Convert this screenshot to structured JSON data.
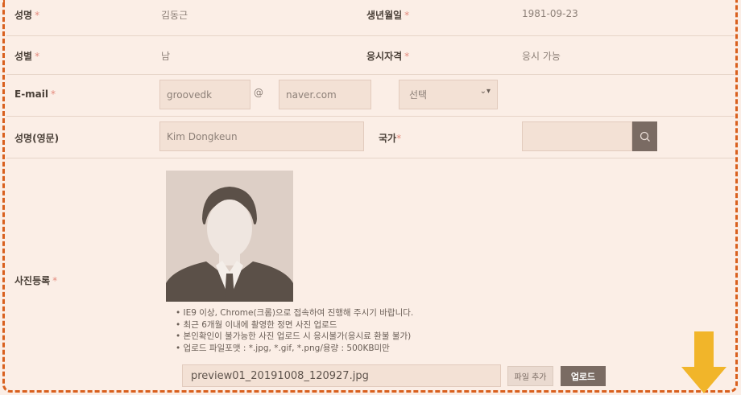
{
  "form": {
    "name_label": "성명",
    "name_value": "김동근",
    "birth_label": "생년월일",
    "birth_value": "1981-09-23",
    "gender_label": "성별",
    "gender_value": "남",
    "qual_label": "응시자격",
    "qual_value": "응시 가능",
    "email_label": "E-mail",
    "email_user": "groovedk",
    "email_at": "@",
    "email_domain": "naver.com",
    "email_select": "선택",
    "eng_name_label": "성명(영문)",
    "eng_name_value": "Kim Dongkeun",
    "country_label": "국가",
    "country_value": "",
    "photo_label": "사진등록",
    "required_mark": "*"
  },
  "photo": {
    "notes": [
      "IE9 이상, Chrome(크롬)으로 접속하여 진행해 주시기 바랍니다.",
      "최근 6개월 이내에 촬영한 정면 사진 업로드",
      "본인확인이 불가능한 사진 업로드 시 응시불가(응시료 환불 불가)",
      "업로드 파일포맷 : *.jpg, *.gif, *.png/용량 : 500KB미만"
    ],
    "file_name": "preview01_20191008_120927.jpg",
    "add_button": "파일 추가",
    "upload_button": "업로드"
  },
  "colors": {
    "accent": "#d9601e",
    "arrow": "#f1b52a",
    "button_dark": "#7a6b63"
  }
}
